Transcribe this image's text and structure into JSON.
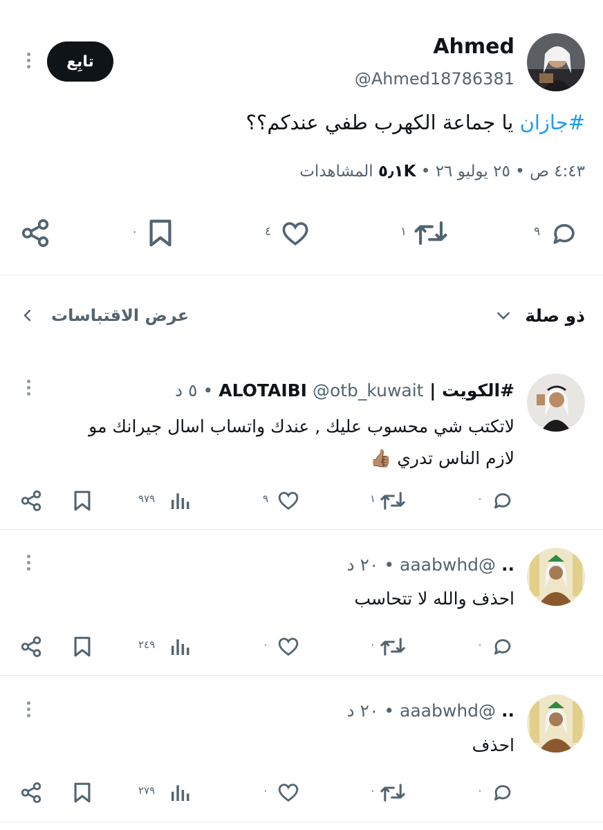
{
  "main_tweet": {
    "author_name": "Ahmed",
    "author_handle": "@Ahmed18786381",
    "follow_label": "تابِع",
    "hashtag": "#جازان",
    "text": "يا جماعة الكهرب طفي عندكم؟؟",
    "meta_time": "٤:٤٣ ص • ٢٥ يوليو ٢٦ •",
    "views_count": "٥٫١K",
    "views_label": "المشاهدات",
    "actions": {
      "replies": "٩",
      "retweets": "١",
      "likes": "٤",
      "bookmarks": "٠"
    }
  },
  "filter_bar": {
    "sort_label": "ذو صلة",
    "quotes_label": "عرض الاقتباسات"
  },
  "replies": [
    {
      "name": "#الكويت | ALOTAIBI",
      "handle": "@otb_kuwait",
      "time": "• ٥ د",
      "text_line1": "لاتكتب شي محسوب عليك , عندك واتساب اسال جيرانك مو",
      "text_line2": "لازم الناس تدري 👍🏽",
      "replies": "٠",
      "retweets": "١",
      "likes": "٩",
      "views": "٩٧٩"
    },
    {
      "name": "..",
      "handle": "@aaabwhd",
      "time": "• ٢٠ د",
      "text_line1": "احذف والله لا تتحاسب",
      "replies": "٠",
      "retweets": "٠",
      "likes": "٠",
      "views": "٢٤٩"
    },
    {
      "name": "..",
      "handle": "@aaabwhd",
      "time": "• ٢٠ د",
      "text_line1": "احذف",
      "replies": "٠",
      "retweets": "٠",
      "likes": "٠",
      "views": "٢٧٩"
    }
  ],
  "colors": {
    "link_blue": "#1d9bf0",
    "secondary_text": "#536471",
    "primary_text": "#0f1419"
  }
}
